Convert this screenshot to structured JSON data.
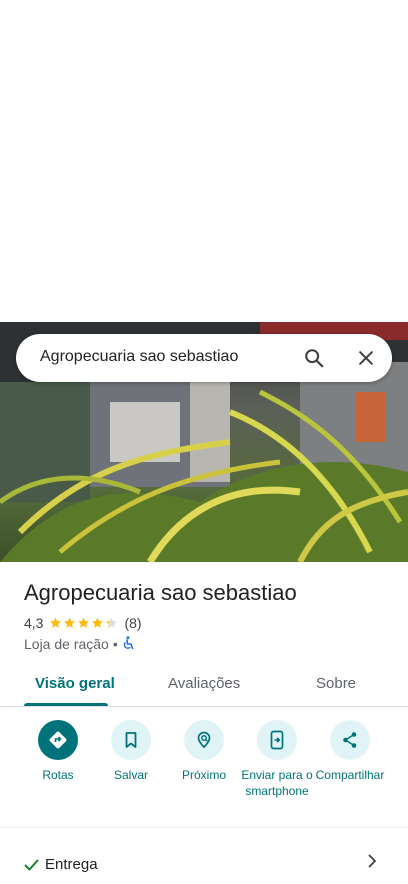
{
  "search": {
    "query": "Agropecuaria sao sebastiao",
    "search_icon": "search-icon",
    "close_icon": "close-icon"
  },
  "place": {
    "name": "Agropecuaria sao sebastiao",
    "rating": "4,3",
    "rating_fraction": 0.86,
    "review_count": "(8)",
    "category": "Loja de ração",
    "separator": "•",
    "accessibility_icon": "wheelchair-icon"
  },
  "tabs": [
    {
      "label": "Visão geral",
      "active": true
    },
    {
      "label": "Avaliações",
      "active": false
    },
    {
      "label": "Sobre",
      "active": false
    }
  ],
  "actions": [
    {
      "label": "Rotas",
      "icon": "directions-icon"
    },
    {
      "label": "Salvar",
      "icon": "bookmark-icon"
    },
    {
      "label": "Próximo",
      "icon": "nearby-icon"
    },
    {
      "label": "Enviar para o smartphone",
      "icon": "send-to-phone-icon"
    },
    {
      "label": "Compartilhar",
      "icon": "share-icon"
    }
  ],
  "services": [
    {
      "label": "Entrega",
      "available": true
    }
  ],
  "colors": {
    "accent": "#00737a",
    "accent_light": "#e0f4f7",
    "star": "#fbbc04",
    "text": "#202124",
    "secondary": "#5f6368",
    "accessibility": "#1a73e8"
  }
}
